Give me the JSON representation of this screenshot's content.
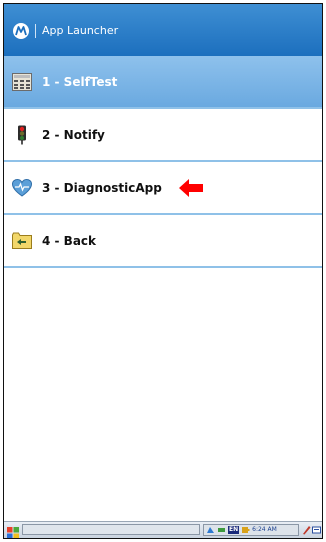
{
  "window": {
    "title": "App Launcher",
    "logo_icon": "motorola-logo-icon"
  },
  "items": [
    {
      "label": "1 - SelfTest",
      "icon": "keypad-icon",
      "selected": true
    },
    {
      "label": "2 - Notify",
      "icon": "traffic-light-icon",
      "selected": false
    },
    {
      "label": "3 - DiagnosticApp",
      "icon": "heart-diagnostic-icon",
      "selected": false
    },
    {
      "label": "4 - Back",
      "icon": "folder-back-icon",
      "selected": false
    }
  ],
  "annotation": {
    "arrow_icon": "red-arrow-icon",
    "color": "#ff0000"
  },
  "taskbar": {
    "language": "EN",
    "time": "6:24 AM"
  },
  "colors": {
    "titlebar": "#1c6fbe",
    "selected_row": "#6aa9e0",
    "separator": "#8fc1e8"
  }
}
